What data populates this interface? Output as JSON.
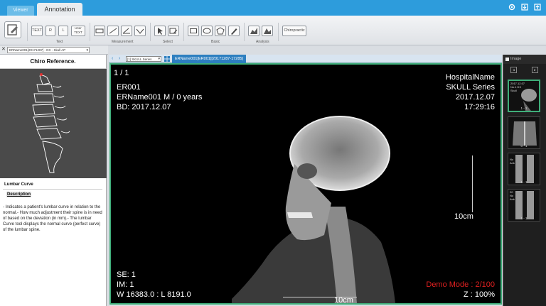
{
  "tabs": [
    {
      "label": "Viewer"
    },
    {
      "label": "Annotation"
    }
  ],
  "toolbar": {
    "text_buttons": [
      "TEXT",
      "R",
      "L",
      "User TEXT"
    ],
    "group_labels": {
      "text": "Text",
      "measurement": "Measurement",
      "select": "Select",
      "basic": "Basic",
      "analysis": "Analysis"
    },
    "chiropractic_label": "Chiropractic"
  },
  "study": {
    "select_value": "ERName001[20171287] - DX - Skull AP"
  },
  "left_panel": {
    "title": "Chiro Reference.",
    "tool_title": "Lumbar Curve",
    "description_label": "Description",
    "description": "- Indicates a patient's lumbar curve in relation to the normal.- How much adjustment their spine is in need of based on the deviation (in mm).- The lumbar Curve tool displays the normal curve (perfect curve) of the lumbar spine."
  },
  "viewer": {
    "series_select": "[1] SKULL Series",
    "title": "ERName001[ER001][20171287-17285]"
  },
  "overlay": {
    "frame": "1 / 1",
    "patient_id": "ER001",
    "patient_name_age": "ERName001 M / 0 years",
    "birth_date": "BD: 2017.12.07",
    "hospital": "HospitalName",
    "series": "SKULL Series",
    "study_date": "2017.12.07",
    "study_time": "17:29:16",
    "scale_v": "10cm",
    "scale_h": "10cm",
    "se": "SE: 1",
    "im": "IM: 1",
    "window_level": "W 16383.0 : L 8191.0",
    "demo_mode": "Demo Mode : 2/100",
    "zoom": "Z : 100%"
  },
  "right_panel": {
    "header": "Image",
    "thumbnails": [
      {
        "label": "2017.12.07\nNo.1 DX\nSkull",
        "index": "1 - 1"
      },
      {
        "label": "",
        "index": "0 - 1"
      },
      {
        "label": "No\nAnk",
        "index": "1 - 1"
      },
      {
        "label": "20\nNo\nAnk",
        "index": "1 - 1"
      }
    ]
  },
  "colors": {
    "title_bar": "#2d9cdc",
    "active_frame": "#3fae7a",
    "demo_text": "#e02020"
  }
}
